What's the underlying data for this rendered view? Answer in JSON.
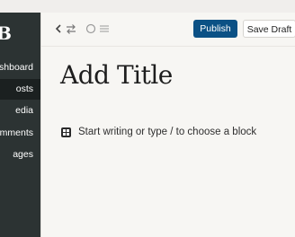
{
  "sidebar": {
    "logo": "B",
    "items": [
      {
        "label": "ashboard",
        "active": false
      },
      {
        "label": "osts",
        "active": true
      },
      {
        "label": "edia",
        "active": false
      },
      {
        "label": "omments",
        "active": false
      },
      {
        "label": "ages",
        "active": false
      }
    ]
  },
  "toolbar": {
    "icons": [
      "chevron-left-icon",
      "swap-icon",
      "status-circle-icon",
      "menu-lines-icon"
    ],
    "publish_label": "Publish",
    "save_label": "Save Draft"
  },
  "editor": {
    "title_placeholder": "Add Title",
    "block_prompt": "Start writing or type / to choose a block"
  },
  "colors": {
    "sidebar_bg": "#2c3333",
    "sidebar_active_bg": "#1b2020",
    "publish_bg": "#0b5185",
    "canvas_bg": "#f7f6f3"
  }
}
